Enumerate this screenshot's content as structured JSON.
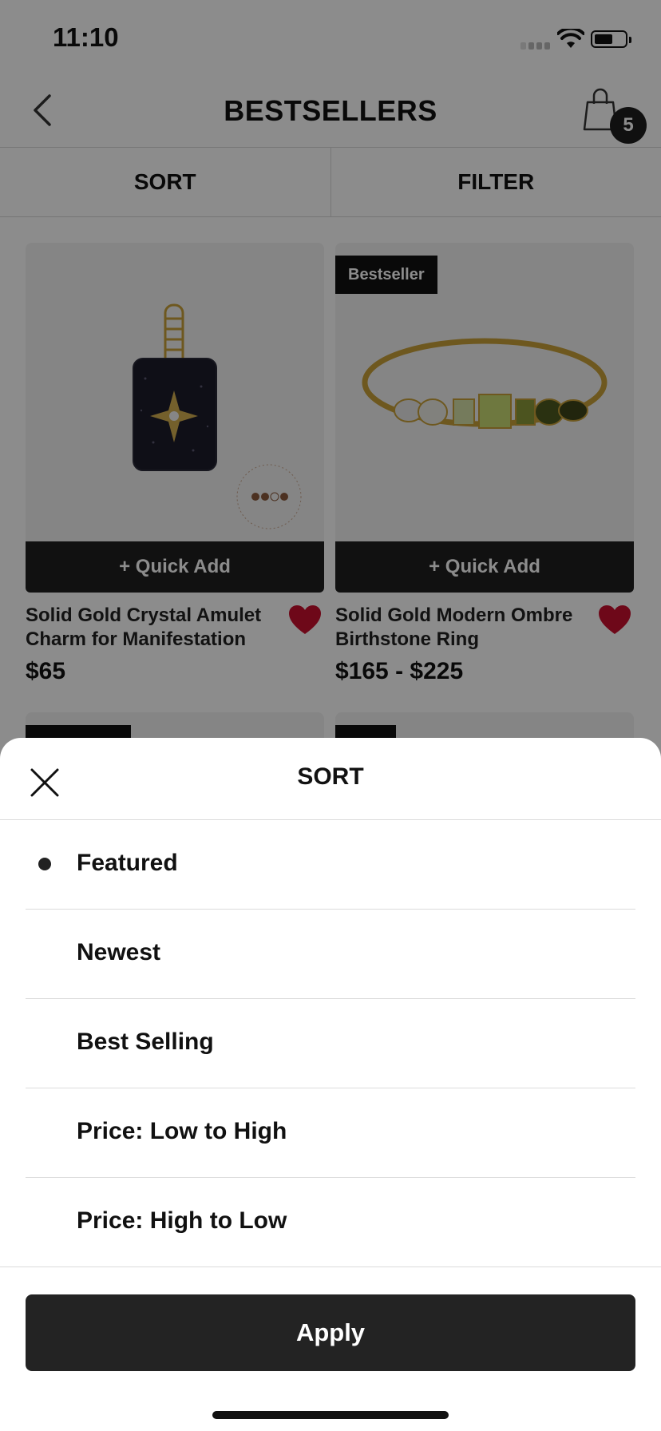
{
  "status_bar": {
    "time": "11:10"
  },
  "header": {
    "title": "BESTSELLERS",
    "cart_count": "5"
  },
  "toolbar": {
    "sort_label": "SORT",
    "filter_label": "FILTER"
  },
  "products": [
    {
      "name": "Solid Gold Crystal Amulet Charm for Manifestation",
      "price": "$65",
      "quick_add": "+ Quick Add",
      "badge": ""
    },
    {
      "name": "Solid Gold Modern Ombre Birthstone Ring",
      "price": "$165 - $225",
      "quick_add": "+ Quick Add",
      "badge": "Bestseller"
    }
  ],
  "sort_sheet": {
    "title": "SORT",
    "selected_index": 0,
    "options": [
      {
        "label": "Featured"
      },
      {
        "label": "Newest"
      },
      {
        "label": "Best Selling"
      },
      {
        "label": "Price: Low to High"
      },
      {
        "label": "Price: High to Low"
      }
    ],
    "apply_label": "Apply"
  },
  "colors": {
    "favorite": "#c8102e",
    "dark": "#1f1f1f",
    "overlay": "rgba(0,0,0,0.45)"
  },
  "icons": [
    "back-chevron-icon",
    "shopping-bag-icon",
    "heart-icon",
    "close-icon",
    "wifi-icon",
    "battery-icon"
  ]
}
